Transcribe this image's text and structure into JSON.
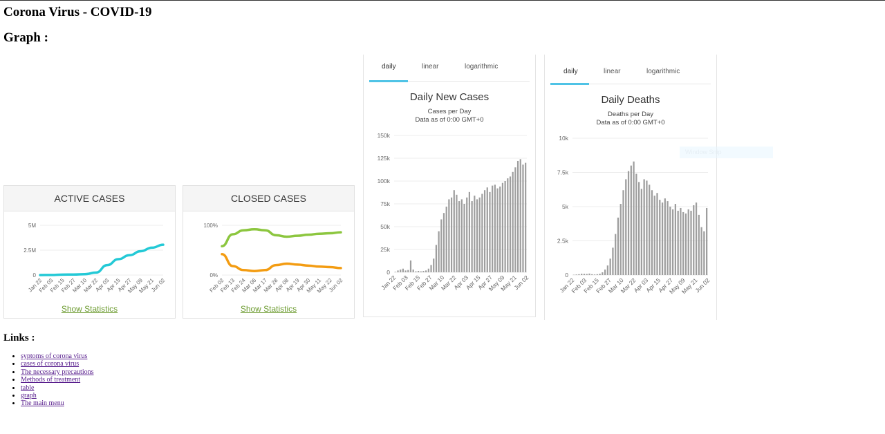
{
  "page": {
    "title": "Corona Virus - COVID-19",
    "graph_heading": "Graph :",
    "links_heading": "Links :"
  },
  "links": [
    "syptoms of corona virus",
    "cases of corona virus",
    "The necessary precautions",
    "Methods of treatment",
    "table",
    "graph",
    "The main menu"
  ],
  "widgets": {
    "active": {
      "title": "ACTIVE CASES",
      "link": "Show Statistics"
    },
    "closed": {
      "title": "CLOSED CASES",
      "link": "Show Statistics"
    },
    "new_cases": {
      "tabs": [
        "daily",
        "linear",
        "logarithmic"
      ],
      "title": "Daily New Cases",
      "subtitle1": "Cases per Day",
      "subtitle2": "Data as of 0:00 GMT+0"
    },
    "deaths": {
      "tabs": [
        "daily",
        "linear",
        "logarithmic"
      ],
      "title": "Daily Deaths",
      "subtitle1": "Deaths per Day",
      "subtitle2": "Data as of 0:00 GMT+0"
    }
  },
  "watermark": "Window Snip",
  "colors": {
    "active_line": "#23c9d6",
    "closed_green": "#8cc63f",
    "closed_orange": "#f39c12",
    "bars": "#9e9e9e",
    "tab_accent": "#4fc3e6",
    "link_green": "#6c9b2f"
  },
  "chart_data": [
    {
      "type": "line",
      "title": "ACTIVE CASES",
      "y_ticks": [
        "0",
        "2.5M",
        "5M"
      ],
      "ylim": [
        0,
        5000000
      ],
      "x_ticks": [
        "Jan 22",
        "Feb 03",
        "Feb 15",
        "Feb 27",
        "Mar 10",
        "Mar 22",
        "Apr 03",
        "Apr 15",
        "Apr 27",
        "May 09",
        "May 21",
        "Jun 02"
      ],
      "series": [
        {
          "values": [
            500,
            10000,
            45000,
            55000,
            90000,
            250000,
            1000000,
            1600000,
            2000000,
            2400000,
            2750000,
            3050000
          ]
        }
      ]
    },
    {
      "type": "line",
      "title": "CLOSED CASES",
      "y_ticks": [
        "0%",
        "100%"
      ],
      "ylim": [
        0,
        100
      ],
      "x_ticks": [
        "Feb 02",
        "Feb 13",
        "Feb 24",
        "Mar 06",
        "Mar 17",
        "Mar 28",
        "Apr 08",
        "Apr 19",
        "Apr 30",
        "May 11",
        "May 22",
        "Jun 02"
      ],
      "series": [
        {
          "values": [
            58,
            82,
            90,
            92,
            90,
            80,
            77,
            79,
            81,
            83,
            84,
            86
          ]
        },
        {
          "values": [
            42,
            18,
            10,
            8,
            10,
            20,
            23,
            21,
            19,
            17,
            16,
            14
          ]
        }
      ]
    },
    {
      "type": "bar",
      "title": "Daily New Cases",
      "y_ticks": [
        "0",
        "25k",
        "50k",
        "75k",
        "100k",
        "125k",
        "150k"
      ],
      "ylim": [
        0,
        150000
      ],
      "x_ticks": [
        "Jan 22",
        "Feb 03",
        "Feb 15",
        "Feb 27",
        "Mar 10",
        "Mar 22",
        "Apr 03",
        "Apr 15",
        "Apr 27",
        "May 09",
        "May 21",
        "Jun 02"
      ],
      "period": {
        "x_start": "Jan 22",
        "x_end": "Jun 02"
      },
      "values": [
        500,
        2000,
        3000,
        4000,
        2000,
        2500,
        13000,
        3000,
        1000,
        1500,
        1000,
        1500,
        2000,
        4000,
        8000,
        15000,
        30000,
        45000,
        58000,
        65000,
        72000,
        80000,
        82000,
        90000,
        85000,
        78000,
        80000,
        75000,
        82000,
        88000,
        78000,
        84000,
        80000,
        82000,
        86000,
        90000,
        93000,
        88000,
        95000,
        96000,
        92000,
        94000,
        98000,
        100000,
        103000,
        105000,
        110000,
        115000,
        122000,
        124000,
        118000,
        120000
      ]
    },
    {
      "type": "bar",
      "title": "Daily Deaths",
      "y_ticks": [
        "0",
        "2.5k",
        "5k",
        "7.5k",
        "10k"
      ],
      "ylim": [
        0,
        10000
      ],
      "x_ticks": [
        "Jan 22",
        "Feb 03",
        "Feb 15",
        "Feb 27",
        "Mar 10",
        "Mar 22",
        "Apr 03",
        "Apr 15",
        "Apr 27",
        "May 09",
        "May 21",
        "Jun 02"
      ],
      "period": {
        "x_start": "Jan 22",
        "x_end": "Jun 02"
      },
      "values": [
        20,
        40,
        60,
        100,
        90,
        80,
        110,
        60,
        40,
        60,
        100,
        200,
        400,
        700,
        1200,
        2000,
        3000,
        4200,
        5200,
        6200,
        7000,
        7600,
        8000,
        8300,
        7400,
        6800,
        6300,
        7000,
        6900,
        6600,
        6200,
        5800,
        6000,
        5500,
        5300,
        5600,
        5400,
        5000,
        4800,
        5200,
        4700,
        4900,
        4600,
        4500,
        4800,
        4700,
        5100,
        5300,
        4400,
        3500,
        3200,
        4900
      ]
    }
  ]
}
